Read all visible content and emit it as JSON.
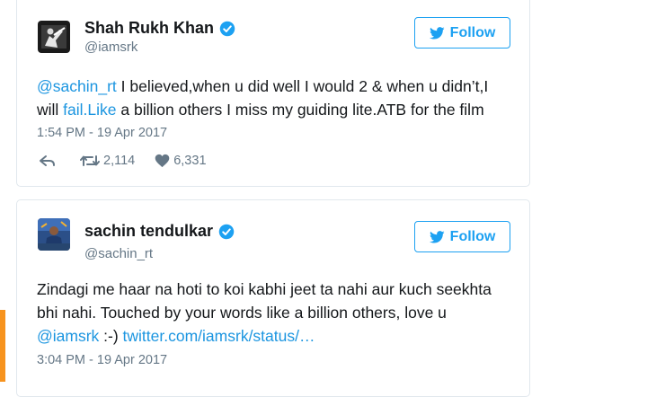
{
  "tweet1": {
    "display_name": "Shah Rukh Khan",
    "handle": "@iamsrk",
    "follow_label": "Follow",
    "text_mention": "@sachin_rt",
    "text_part1": " I believed,when u did well I would 2 & when u didn’t,I will ",
    "text_fail": "fail.",
    "text_like": "Like",
    "text_part2": " a billion others I miss my guiding lite.ATB for the film",
    "timestamp": "1:54 PM - 19 Apr 2017",
    "retweets": "2,114",
    "likes": "6,331"
  },
  "tweet2": {
    "display_name": "sachin tendulkar",
    "handle": "@sachin_rt",
    "follow_label": "Follow",
    "text_part1": "Zindagi me haar na hoti to koi kabhi jeet ta nahi aur kuch seekhta bhi nahi. Touched by your words like a billion others, love u ",
    "text_mention": "@iamsrk",
    "text_part2": " :-) ",
    "text_link": "twitter.com/iamsrk/status/…",
    "timestamp": "3:04 PM - 19 Apr 2017"
  },
  "colors": {
    "link": "#1b95e0",
    "follow": "#1da1f2",
    "verified": "#1da1f2",
    "muted": "#657786",
    "accent": "#f7931e"
  },
  "icons": [
    "verified-badge-icon",
    "twitter-bird-icon",
    "reply-icon",
    "retweet-icon",
    "heart-icon"
  ]
}
